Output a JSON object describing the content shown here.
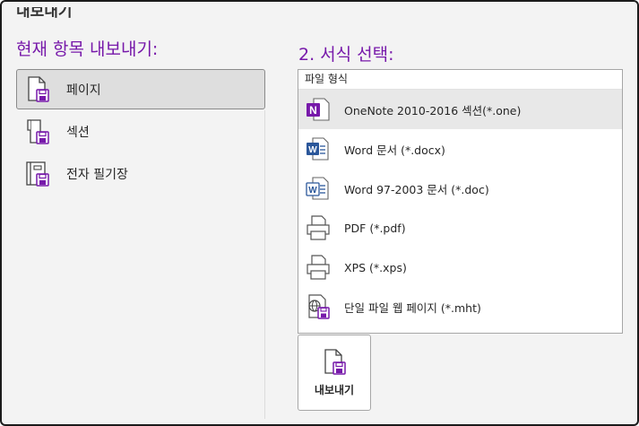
{
  "window": {
    "title": "내보내기"
  },
  "left_panel": {
    "heading": "현재 항목 내보내기:",
    "items": [
      {
        "label": "페이지",
        "icon": "page-export-icon",
        "selected": true
      },
      {
        "label": "섹션",
        "icon": "section-export-icon",
        "selected": false
      },
      {
        "label": "전자 필기장",
        "icon": "notebook-export-icon",
        "selected": false
      }
    ]
  },
  "right_panel": {
    "heading": "2. 서식 선택:",
    "list_header": "파일 형식",
    "formats": [
      {
        "label": "OneNote 2010-2016 섹션(*.one)",
        "icon": "onenote-icon",
        "selected": true
      },
      {
        "label": "Word 문서 (*.docx)",
        "icon": "word-docx-icon",
        "selected": false
      },
      {
        "label": "Word 97-2003 문서 (*.doc)",
        "icon": "word-doc-icon",
        "selected": false
      },
      {
        "label": "PDF (*.pdf)",
        "icon": "pdf-printer-icon",
        "selected": false
      },
      {
        "label": "XPS (*.xps)",
        "icon": "xps-printer-icon",
        "selected": false
      },
      {
        "label": "단일 파일 웹 페이지 (*.mht)",
        "icon": "web-page-icon",
        "selected": false
      }
    ],
    "export_button": {
      "label": "내보내기",
      "icon": "export-save-icon"
    }
  },
  "colors": {
    "accent": "#7719aa",
    "word_blue": "#2b579a",
    "selected_bg": "#dedede",
    "panel_bg": "#f3f3f3"
  }
}
